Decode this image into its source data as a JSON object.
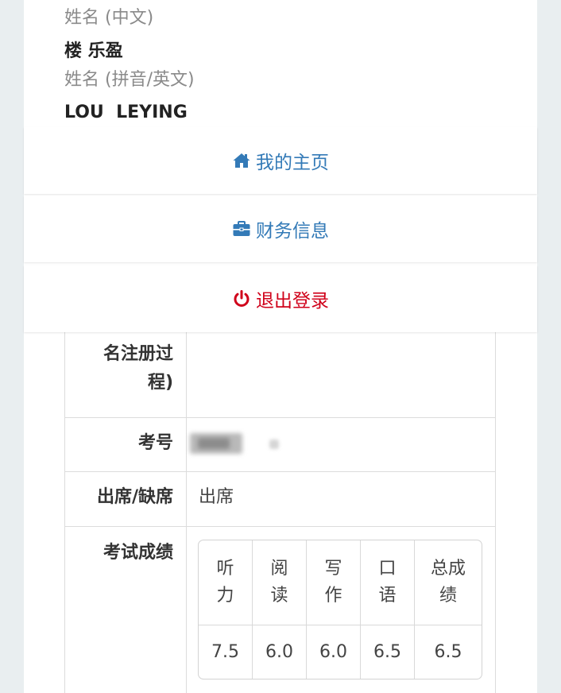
{
  "user": {
    "name_cn_label": "姓名 (中文)",
    "name_cn": "楼 乐盈",
    "name_en_label": "姓名 (拼音/英文)",
    "name_en": "LOU  LEYING"
  },
  "menu": {
    "home": "我的主页",
    "finance": "财务信息",
    "logout": "退出登录"
  },
  "record": {
    "partial_label_line1": "名注册过",
    "partial_label_line2": "程)",
    "exam_no_label": "考号",
    "attendance_label": "出席/缺席",
    "attendance_value": "出席",
    "scores_label": "考试成绩"
  },
  "scores": {
    "headers": [
      {
        "l1": "听",
        "l2": "力"
      },
      {
        "l1": "阅",
        "l2": "读"
      },
      {
        "l1": "写",
        "l2": "作"
      },
      {
        "l1": "口",
        "l2": "语"
      },
      {
        "l1": "总成",
        "l2": "绩"
      }
    ],
    "values": [
      "7.5",
      "6.0",
      "6.0",
      "6.5",
      "6.5"
    ]
  },
  "colors": {
    "link": "#337ab7",
    "danger": "#d0021b"
  },
  "icons": {
    "home": "home-icon",
    "finance": "briefcase-icon",
    "logout": "power-icon"
  }
}
